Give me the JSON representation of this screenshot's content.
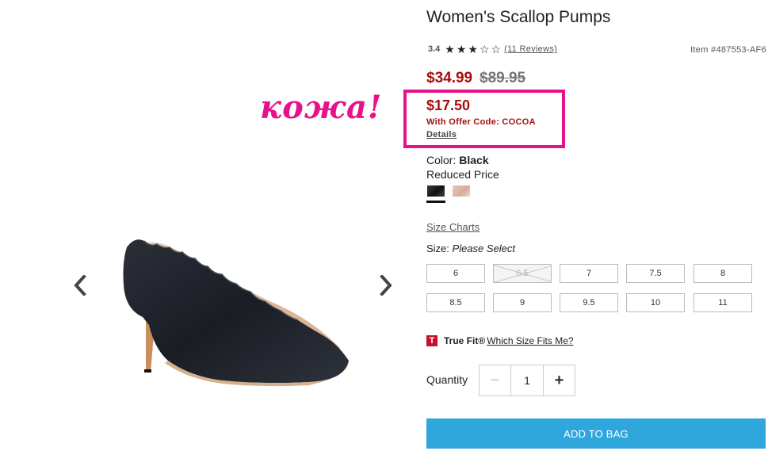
{
  "annotation": {
    "text": "кожа!",
    "color": "#e8118a"
  },
  "product": {
    "title": "Women's Scallop Pumps",
    "rating_value": "3.4",
    "stars_filled": 3,
    "stars_total": 5,
    "reviews_text": "(11 Reviews)",
    "item_number": "Item #487553-AF6"
  },
  "pricing": {
    "sale_price": "$34.99",
    "original_price": "$89.95",
    "offer_price": "$17.50",
    "offer_code_text": "With Offer Code: COCOA",
    "details_link": "Details",
    "sale_color": "#a50e0e"
  },
  "color": {
    "label": "Color:",
    "selected": "Black",
    "note": "Reduced Price",
    "swatches": [
      "Black",
      "Nude"
    ]
  },
  "sizes": {
    "charts_link": "Size Charts",
    "label": "Size:",
    "prompt": "Please Select",
    "options": [
      {
        "value": "6",
        "available": true
      },
      {
        "value": "6.5",
        "available": false
      },
      {
        "value": "7",
        "available": true
      },
      {
        "value": "7.5",
        "available": true
      },
      {
        "value": "8",
        "available": true
      },
      {
        "value": "8.5",
        "available": true
      },
      {
        "value": "9",
        "available": true
      },
      {
        "value": "9.5",
        "available": true
      },
      {
        "value": "10",
        "available": true
      },
      {
        "value": "11",
        "available": true
      }
    ]
  },
  "truefit": {
    "logo": "T",
    "brand": "True Fit®",
    "link": "Which Size Fits Me?"
  },
  "quantity": {
    "label": "Quantity",
    "value": "1",
    "minus": "−",
    "plus": "+"
  },
  "cta": {
    "add_to_bag": "ADD TO BAG",
    "color": "#2fa7dc"
  },
  "icons": {
    "prev": "chevron-left-icon",
    "next": "chevron-right-icon"
  }
}
